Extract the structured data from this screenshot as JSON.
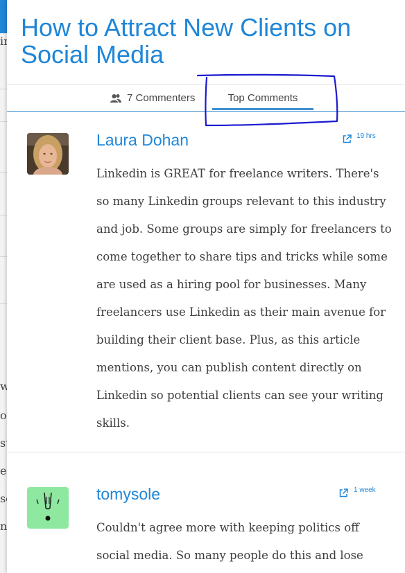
{
  "article": {
    "title": "How to Attract New Clients on Social Media"
  },
  "tabs": {
    "commenters_label": "7 Commenters",
    "top_comments_label": "Top Comments"
  },
  "comments": [
    {
      "author": "Laura Dohan",
      "time": "19 hrs",
      "text": "Linkedin is GREAT for freelance writers. There's so many Linkedin groups relevant to this industry and job. Some groups are simply for freelancers to come together to share tips and tricks while some are used as a hiring pool for businesses. Many freelancers use Linkedin as their main avenue for building their client base. Plus, as this article mentions, you can publish content directly on Linkedin so potential clients can see your writing skills."
    },
    {
      "author": "tomysole",
      "time": "1 week",
      "text": "Couldn't agree more with keeping politics off social media. So many people do this and lose"
    }
  ],
  "background_page": {
    "visible_chars": [
      "ir",
      "w",
      "ol",
      "st",
      "er",
      "se",
      "nt"
    ]
  },
  "colors": {
    "accent": "#1f86d8",
    "annotation": "#1a1ad0",
    "avatar_green": "#8ee8a0"
  },
  "icons": {
    "commenters": "people-icon",
    "permalink": "external-link-icon"
  }
}
